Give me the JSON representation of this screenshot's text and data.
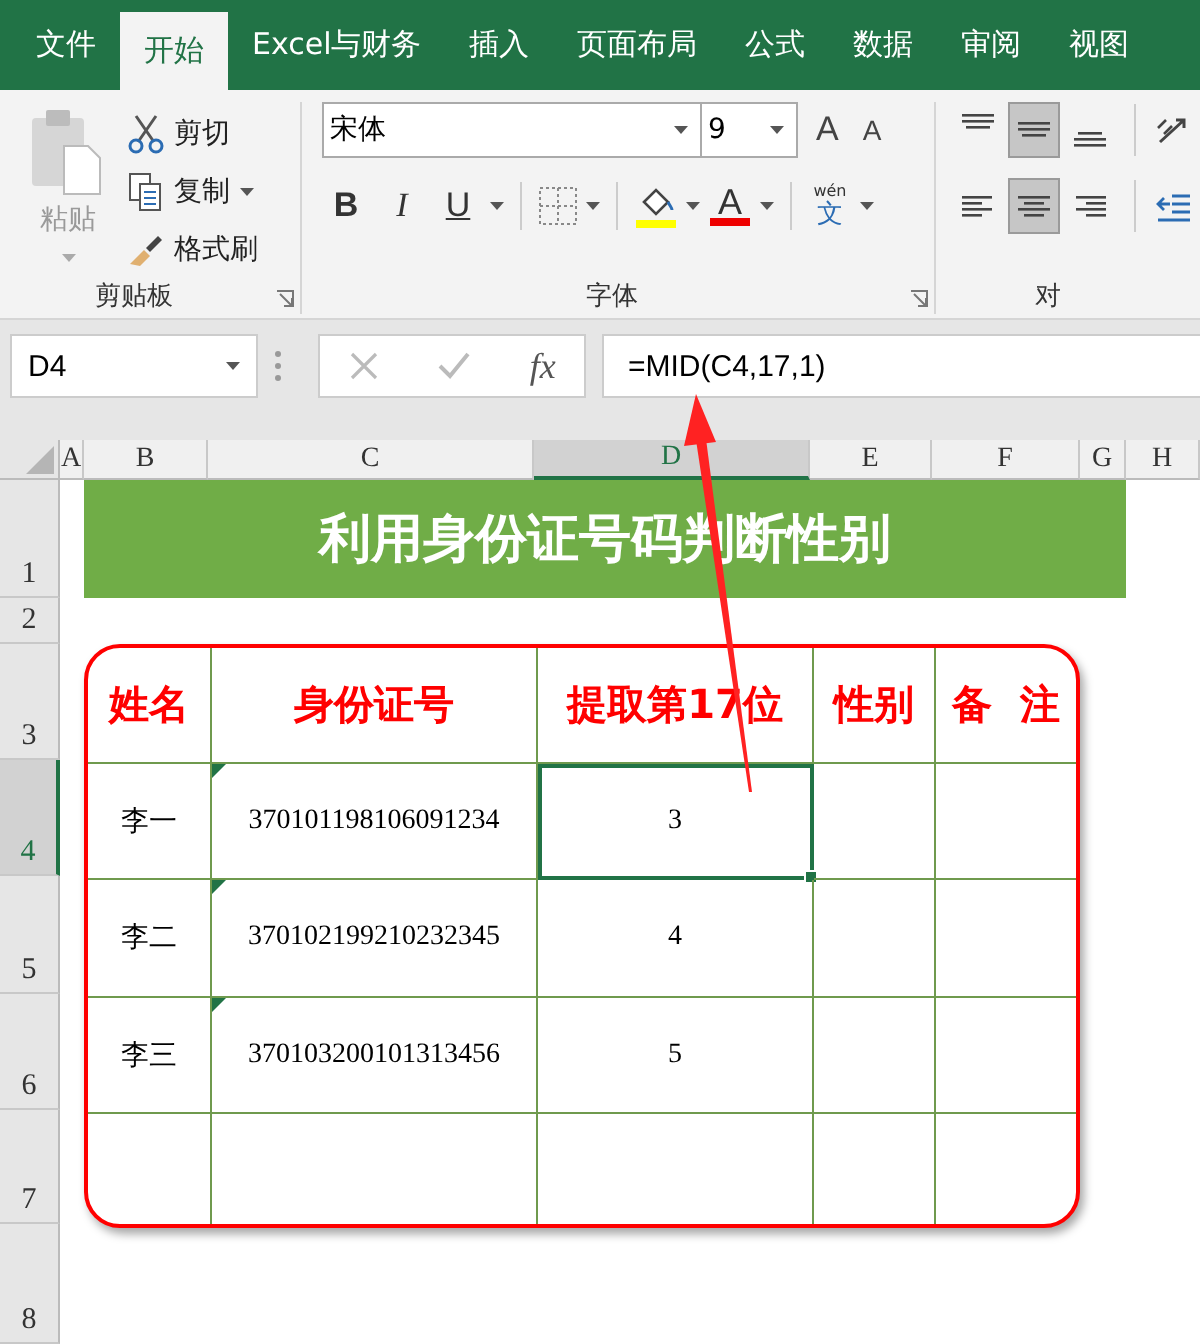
{
  "tabs": [
    {
      "label": "文件",
      "selected": false
    },
    {
      "label": "开始",
      "selected": true
    },
    {
      "label": "Excel与财务",
      "selected": false
    },
    {
      "label": "插入",
      "selected": false
    },
    {
      "label": "页面布局",
      "selected": false
    },
    {
      "label": "公式",
      "selected": false
    },
    {
      "label": "数据",
      "selected": false
    },
    {
      "label": "审阅",
      "selected": false
    },
    {
      "label": "视图",
      "selected": false
    }
  ],
  "ribbon": {
    "clipboard": {
      "group": "剪贴板",
      "paste": {
        "label": "粘贴",
        "disabled": true
      },
      "cut": "剪切",
      "copy": "复制",
      "format_painter": "格式刷"
    },
    "font": {
      "group": "字体",
      "font_name": "宋体",
      "font_size": "9",
      "grow": "A",
      "shrink": "A",
      "bold": "B",
      "italic": "I",
      "underline": "U",
      "font_color": "A",
      "phonetic_top": "wén",
      "phonetic_bottom": "文"
    },
    "alignment": {
      "group": "对",
      "buttons": [
        {
          "kind": "top",
          "selected": false
        },
        {
          "kind": "middle",
          "selected": true
        },
        {
          "kind": "bottom",
          "selected": false
        },
        {
          "kind": "orientation",
          "selected": false
        },
        {
          "kind": "left",
          "selected": false
        },
        {
          "kind": "center",
          "selected": true
        },
        {
          "kind": "right",
          "selected": false
        },
        {
          "kind": "indent",
          "selected": false
        }
      ]
    }
  },
  "formula_bar": {
    "name_box": "D4",
    "function_label": "fx",
    "formula": "=MID(C4,17,1)"
  },
  "columns": [
    {
      "label": "A",
      "selected": false
    },
    {
      "label": "B",
      "selected": false
    },
    {
      "label": "C",
      "selected": false
    },
    {
      "label": "D",
      "selected": true
    },
    {
      "label": "E",
      "selected": false
    },
    {
      "label": "F",
      "selected": false
    },
    {
      "label": "G",
      "selected": false
    },
    {
      "label": "H",
      "selected": false
    }
  ],
  "rows": [
    {
      "label": "1",
      "selected": false
    },
    {
      "label": "2",
      "selected": false
    },
    {
      "label": "3",
      "selected": false
    },
    {
      "label": "4",
      "selected": true
    },
    {
      "label": "5",
      "selected": false
    },
    {
      "label": "6",
      "selected": false
    },
    {
      "label": "7",
      "selected": false
    },
    {
      "label": "8",
      "selected": false
    }
  ],
  "title": "利用身份证号码判断性别",
  "table": {
    "columns": [
      "姓名",
      "身份证号",
      "提取第17位",
      "性别",
      "备  注"
    ],
    "rows": [
      {
        "kind": "data",
        "name": "李一",
        "id_number": "370101198106091234",
        "digit": "3",
        "text_flag": true,
        "digit_selected": true
      },
      {
        "kind": "data",
        "name": "李二",
        "id_number": "370102199210232345",
        "digit": "4",
        "text_flag": true,
        "digit_selected": false
      },
      {
        "kind": "data",
        "name": "李三",
        "id_number": "370103200101313456",
        "digit": "5",
        "text_flag": true,
        "digit_selected": false
      },
      {
        "kind": "blank"
      }
    ]
  }
}
